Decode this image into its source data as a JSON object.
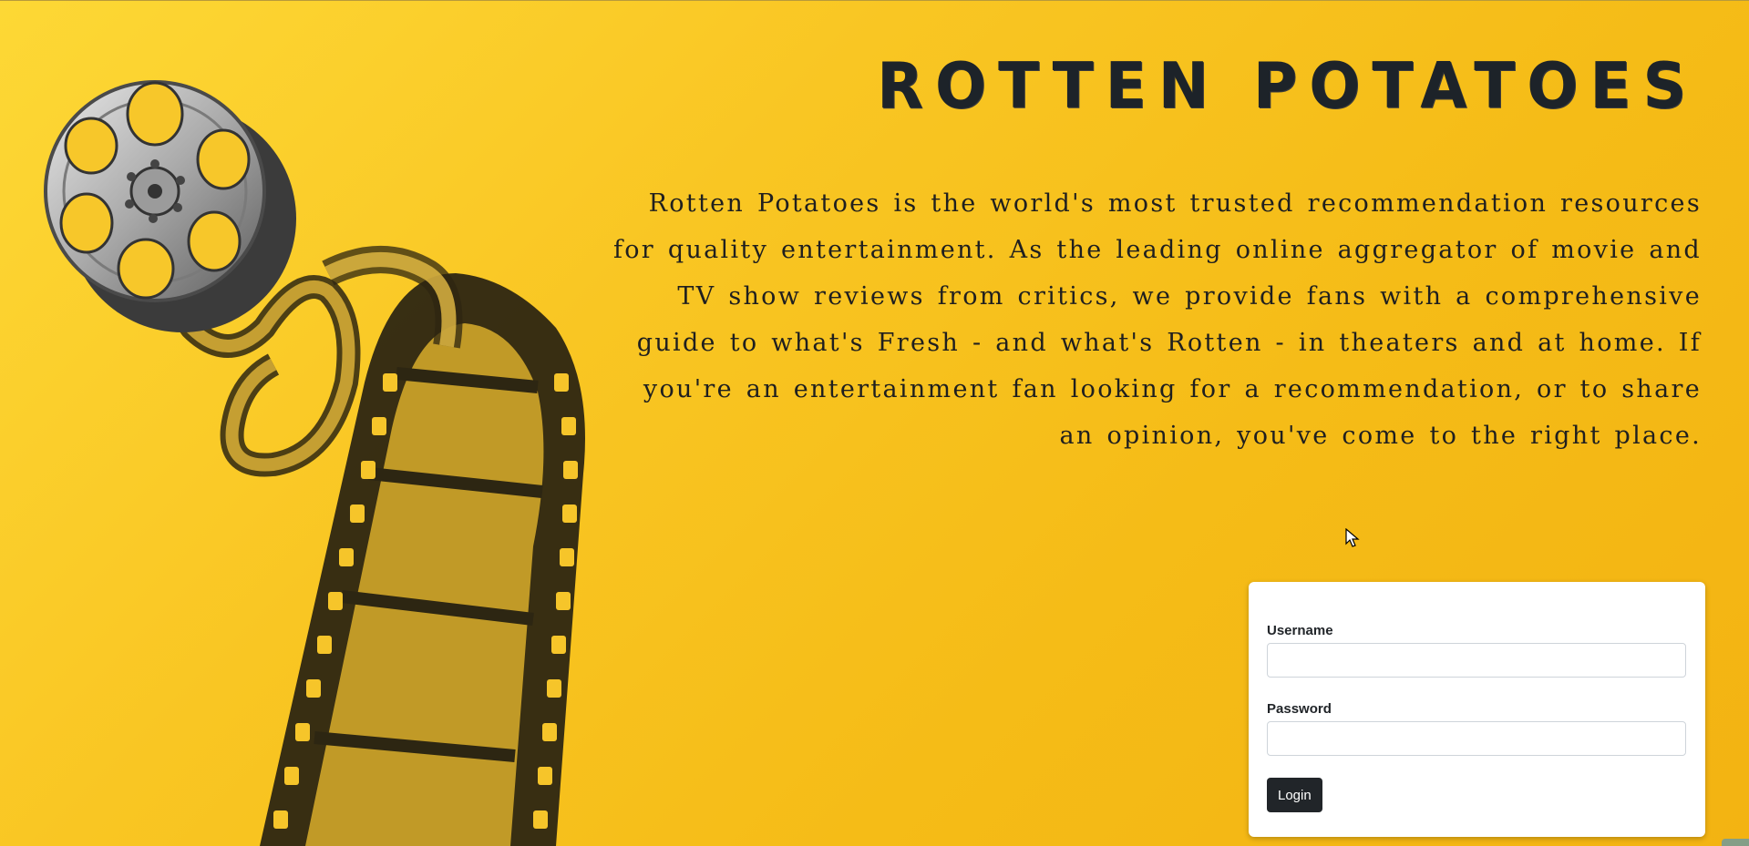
{
  "app": {
    "title": "Rotten Potatoes"
  },
  "hero": {
    "title": "Rotten Potatoes",
    "description": "Rotten Potatoes is the world's most trusted recommendation resources for quality entertainment. As the leading online aggregator of movie and TV show reviews from critics, we provide fans with a comprehensive guide to what's Fresh - and what's Rotten - in theaters and at home. If you're an entertainment fan looking for a recommendation, or to share an opinion, you've come to the right place."
  },
  "illustration": {
    "icon": "film-reel-icon"
  },
  "login": {
    "username_label": "Username",
    "username_value": "",
    "password_label": "Password",
    "password_value": "",
    "button_label": "Login"
  },
  "colors": {
    "background": "#f9c623",
    "title": "#1d2329",
    "button": "#212529"
  }
}
